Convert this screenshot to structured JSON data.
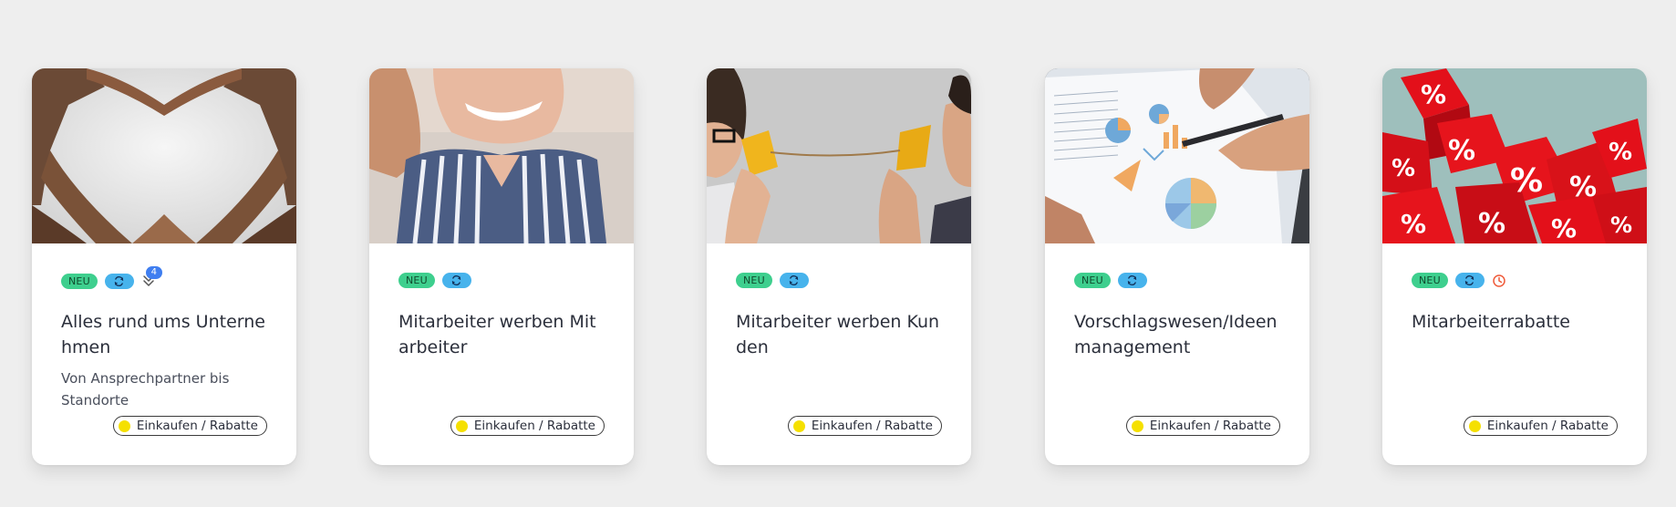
{
  "colors": {
    "neu_badge": "#3ecf8e",
    "sync_badge": "#47b3ec",
    "count_badge": "#3f7ef0",
    "category_dot": "#f5e000",
    "clock_icon": "#ef5b3a"
  },
  "icons": {
    "sync": "sync-icon",
    "flow": "flow-icon",
    "clock": "clock-icon"
  },
  "cards": [
    {
      "badge_new": "NEU",
      "flow_count": "4",
      "title": "Alles rund ums Unternehmen",
      "subtitle": "Von Ansprechpartner bis Standorte",
      "category": "Einkaufen / Rabatte"
    },
    {
      "badge_new": "NEU",
      "title": "Mitarbeiter werben Mitarbeiter",
      "category": "Einkaufen / Rabatte"
    },
    {
      "badge_new": "NEU",
      "title": "Mitarbeiter werben Kunden",
      "category": "Einkaufen / Rabatte"
    },
    {
      "badge_new": "NEU",
      "title": "Vorschlagswesen/Ideenmanagement",
      "category": "Einkaufen / Rabatte"
    },
    {
      "badge_new": "NEU",
      "title": "Mitarbeiterrabatte",
      "category": "Einkaufen / Rabatte"
    }
  ]
}
